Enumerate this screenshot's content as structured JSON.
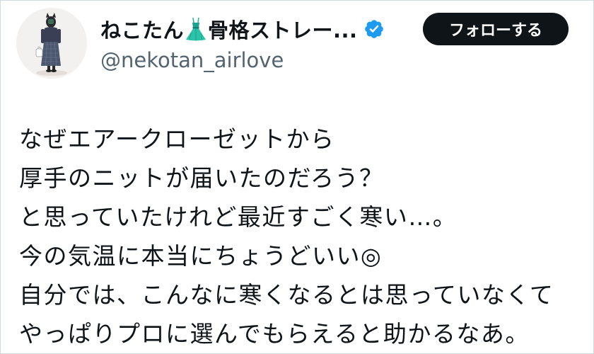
{
  "user": {
    "display_name": "ねこたん",
    "display_name_rest": "骨格ストレー...",
    "name_emoji_icon": "dress-icon",
    "verified_icon": "verified-badge-icon",
    "handle": "@nekotan_airlove",
    "avatar_icon": "avatar-photo"
  },
  "follow_button": {
    "label": "フォローする"
  },
  "tweet": {
    "lines": [
      "なぜエアークローゼットから",
      "厚手のニットが届いたのだろう？",
      "と思っていたけれど最近すごく寒い…。",
      "今の気温に本当にちょうどいい◎",
      "自分では、こんなに寒くなるとは思っていなくて",
      "やっぱりプロに選んでもらえると助かるなあ。"
    ]
  },
  "colors": {
    "text": "#0f1419",
    "secondary_text": "#536471",
    "follow_bg": "#0f1419",
    "follow_text": "#ffffff",
    "verified": "#1d9bf0",
    "border": "#cfd9de"
  }
}
